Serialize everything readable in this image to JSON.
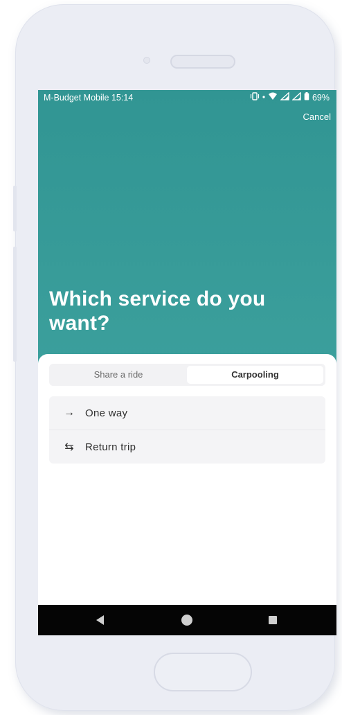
{
  "status_bar": {
    "carrier": "M-Budget Mobile 15:14",
    "battery": "69%"
  },
  "header": {
    "cancel_label": "Cancel",
    "title": "Which service do you want?"
  },
  "tabs": [
    {
      "label": "Share a ride",
      "selected": false
    },
    {
      "label": "Carpooling",
      "selected": true
    }
  ],
  "options": [
    {
      "icon": "arrow-right-icon",
      "glyph": "→",
      "label": "One way"
    },
    {
      "icon": "swap-arrows-icon",
      "glyph": "⇆",
      "label": "Return trip"
    }
  ],
  "colors": {
    "header_bg": "#3a9e9b",
    "sheet_bg": "#ffffff",
    "navbar_bg": "#050505"
  }
}
